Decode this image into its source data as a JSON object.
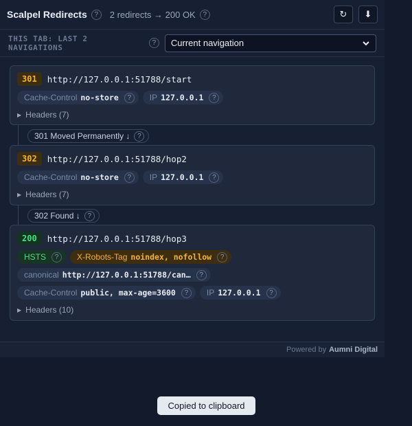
{
  "header": {
    "title": "Scalpel Redirects",
    "summary": "2 redirects → 200 OK",
    "refresh_icon": "↻",
    "download_icon": "⬇"
  },
  "nav": {
    "label": "THIS TAB: LAST 2 NAVIGATIONS",
    "selected": "Current navigation"
  },
  "help_glyph": "?",
  "hops": [
    {
      "status": "301",
      "url": "http://127.0.0.1:51788/start",
      "cache_label": "Cache-Control",
      "cache_value": "no-store",
      "ip_label": "IP",
      "ip_value": "127.0.0.1",
      "headers_label": "Headers (7)"
    },
    {
      "status": "302",
      "url": "http://127.0.0.1:51788/hop2",
      "cache_label": "Cache-Control",
      "cache_value": "no-store",
      "ip_label": "IP",
      "ip_value": "127.0.0.1",
      "headers_label": "Headers (7)"
    },
    {
      "status": "200",
      "url": "http://127.0.0.1:51788/hop3",
      "hsts_label": "HSTS",
      "robots_label": "X-Robots-Tag",
      "robots_value": "noindex, nofollow",
      "canonical_label": "canonical",
      "canonical_value": "http://127.0.0.1:51788/can…",
      "cache_label": "Cache-Control",
      "cache_value": "public, max-age=3600",
      "ip_label": "IP",
      "ip_value": "127.0.0.1",
      "headers_label": "Headers (10)"
    }
  ],
  "transitions": [
    "301 Moved Permanently ↓",
    "302 Found ↓"
  ],
  "footer": {
    "prefix": "Powered by",
    "brand": "Aumni Digital"
  },
  "toast": "Copied to clipboard",
  "colors": {
    "redirect_status": "#f5b13b",
    "ok_status": "#4ade80",
    "background": "#121a2b"
  }
}
